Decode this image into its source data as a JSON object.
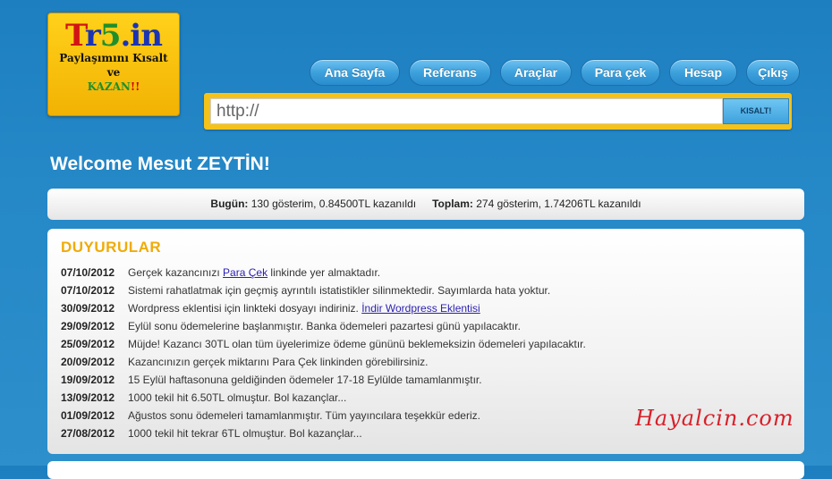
{
  "logo": {
    "title_t": "T",
    "title_r": "r",
    "title_5": "5",
    "title_in": ".in",
    "line1": "Paylaşımını Kısalt",
    "line2": "ve",
    "line3_kazan": "KAZAN",
    "line3_excl": "!!"
  },
  "nav": {
    "items": [
      {
        "label": "Ana Sayfa"
      },
      {
        "label": "Referans"
      },
      {
        "label": "Araçlar"
      },
      {
        "label": "Para çek"
      },
      {
        "label": "Hesap"
      },
      {
        "label": "Çıkış"
      }
    ]
  },
  "shortener": {
    "placeholder": "http://",
    "button_label": "KISALT!"
  },
  "welcome_text": "Welcome Mesut ZEYTİN!",
  "stats": {
    "today_label": "Bugün:",
    "today_value": "130 gösterim, 0.84500TL kazanıldı",
    "total_label": "Toplam:",
    "total_value": "274 gösterim, 1.74206TL kazanıldı"
  },
  "news": {
    "title": "DUYURULAR",
    "items": [
      {
        "date": "07/10/2012",
        "before": "Gerçek kazancınızı ",
        "link": "Para Çek",
        "after": " linkinde yer almaktadır."
      },
      {
        "date": "07/10/2012",
        "before": "Sistemi rahatlatmak için geçmiş ayrıntılı istatistikler silinmektedir. Sayımlarda hata yoktur.",
        "link": "",
        "after": ""
      },
      {
        "date": "30/09/2012",
        "before": "Wordpress eklentisi için linkteki dosyayı indiriniz. ",
        "link": "İndir Wordpress Eklentisi",
        "after": ""
      },
      {
        "date": "29/09/2012",
        "before": "Eylül sonu ödemelerine başlanmıştır. Banka ödemeleri pazartesi günü yapılacaktır.",
        "link": "",
        "after": ""
      },
      {
        "date": "25/09/2012",
        "before": "Müjde! Kazancı 30TL olan tüm üyelerimize ödeme gününü beklemeksizin ödemeleri yapılacaktır.",
        "link": "",
        "after": ""
      },
      {
        "date": "20/09/2012",
        "before": "Kazancınızın gerçek miktarını Para Çek linkinden görebilirsiniz.",
        "link": "",
        "after": ""
      },
      {
        "date": "19/09/2012",
        "before": "15 Eylül haftasonuna geldiğinden ödemeler 17-18 Eylülde tamamlanmıştır.",
        "link": "",
        "after": ""
      },
      {
        "date": "13/09/2012",
        "before": "1000 tekil hit 6.50TL olmuştur. Bol kazançlar...",
        "link": "",
        "after": ""
      },
      {
        "date": "01/09/2012",
        "before": "Ağustos sonu ödemeleri tamamlanmıştır. Tüm yayıncılara teşekkür ederiz.",
        "link": "",
        "after": ""
      },
      {
        "date": "27/08/2012",
        "before": "1000 tekil hit tekrar 6TL olmuştur. Bol kazançlar...",
        "link": "",
        "after": ""
      }
    ]
  },
  "watermark": "Hayalcin.com"
}
